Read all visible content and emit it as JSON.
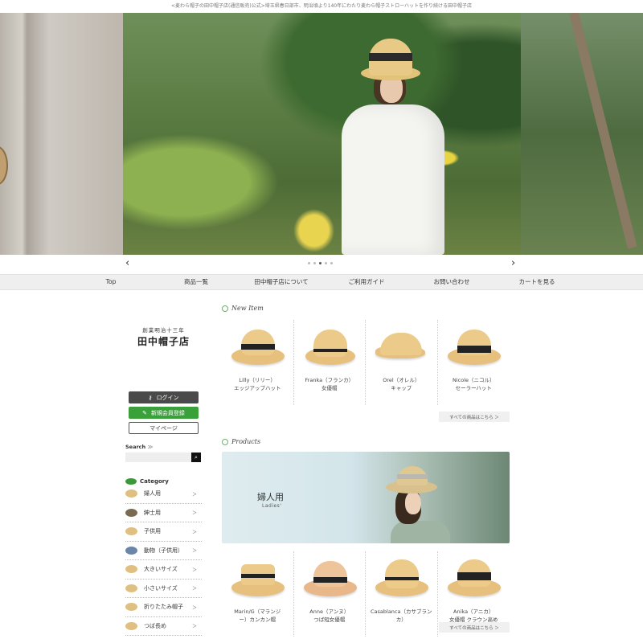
{
  "top_notice": "<麦わら帽子の田中帽子店(通信販売)公式>埼玉県春日部市、明治頃より140年にわたり麦わら帽子ストローハットを作り続ける田中帽子店",
  "slider": {
    "prev_icon": "‹",
    "next_icon": "›",
    "dot_count": 5,
    "active_dot": 2
  },
  "gnav": [
    "Top",
    "商品一覧",
    "田中帽子店について",
    "ご利用ガイド",
    "お問い合わせ",
    "カートを見る"
  ],
  "logo": {
    "small": "創業明治十三年",
    "main": "田中帽子店"
  },
  "buttons": {
    "login": "ログイン",
    "register": "新規会員登録",
    "mypage": "マイページ"
  },
  "search": {
    "label": "Search",
    "arrow": "≫",
    "placeholder": "",
    "button_icon": "search-icon"
  },
  "category": {
    "title": "Category",
    "items": [
      "婦人用",
      "紳士用",
      "子供用",
      "動物（子供用）",
      "大きいサイズ",
      "小さいサイズ",
      "折りたたみ帽子",
      "つば長め"
    ]
  },
  "new_item": {
    "title": "New Item",
    "items": [
      {
        "line1": "Lilly（リリー）",
        "line2": "エッジアップハット"
      },
      {
        "line1": "Franka（フランカ）",
        "line2": "女優帽"
      },
      {
        "line1": "Orel（オレル）",
        "line2": "キャップ"
      },
      {
        "line1": "Nicole（ニコル）",
        "line2": "セーラーハット"
      }
    ],
    "more": "すべての商品はこちら ＞"
  },
  "products": {
    "title": "Products",
    "banner_title": "婦人用",
    "banner_sub": "Ladies'",
    "items": [
      {
        "line1": "Marin/G（マランジ",
        "line2": "ー）カンカン帽"
      },
      {
        "line1": "Anne（アンヌ）",
        "line2": "つば短女優帽"
      },
      {
        "line1": "Casablanca（カサブラン",
        "line2": "カ）"
      },
      {
        "line1": "Anika（アニカ）",
        "line2": "女優帽 クラウン高め"
      }
    ],
    "more": "すべての商品はこちら ＞"
  },
  "colors": {
    "register_green": "#3aa03a",
    "login_gray": "#4a4a4a",
    "straw": "#e6c07c"
  }
}
